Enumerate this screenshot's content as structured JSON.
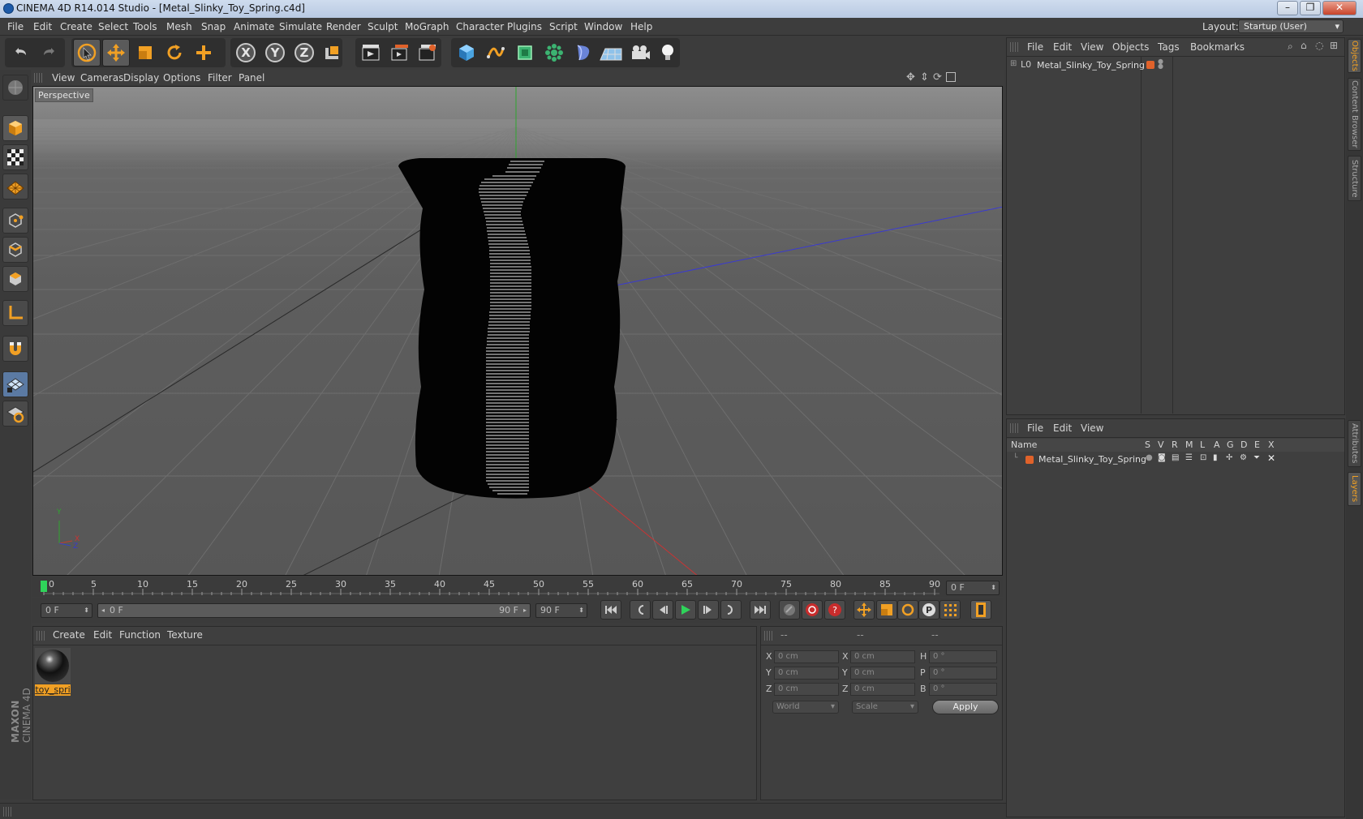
{
  "window": {
    "title": "CINEMA 4D R14.014 Studio - [Metal_Slinky_Toy_Spring.c4d]"
  },
  "menubar": {
    "items": [
      "File",
      "Edit",
      "Create",
      "Select",
      "Tools",
      "Mesh",
      "Snap",
      "Animate",
      "Simulate",
      "Render",
      "Sculpt",
      "MoGraph",
      "Character",
      "Plugins",
      "Script",
      "Window",
      "Help"
    ],
    "layout_label": "Layout:",
    "layout_value": "Startup (User)"
  },
  "toolbar": {
    "icons": [
      "undo-icon",
      "redo-icon",
      "live-select-icon",
      "move-icon",
      "scale-icon",
      "rotate-icon",
      "add-icon",
      "x-axis-icon",
      "y-axis-icon",
      "z-axis-icon",
      "world-coord-icon",
      "render-view-icon",
      "render-picture-viewer-icon",
      "edit-render-settings-icon",
      "cube-icon",
      "spline-icon",
      "nurbs-icon",
      "array-icon",
      "deformer-icon",
      "floor-icon",
      "camera-icon",
      "light-icon"
    ],
    "axis_x": "X",
    "axis_y": "Y",
    "axis_z": "Z"
  },
  "viewport": {
    "menu": [
      "View",
      "Cameras",
      "Display",
      "Options",
      "Filter",
      "Panel"
    ],
    "label": "Perspective",
    "axis_x": "X",
    "axis_y": "Y",
    "axis_z": "Z"
  },
  "timeline": {
    "ticks": [
      "0",
      "5",
      "10",
      "15",
      "20",
      "25",
      "30",
      "35",
      "40",
      "45",
      "50",
      "55",
      "60",
      "65",
      "70",
      "75",
      "80",
      "85",
      "90"
    ],
    "current_frame": "0 F"
  },
  "playbar": {
    "start_frame": "0 F",
    "range_start": "0 F",
    "range_end": "90 F",
    "end_frame": "90 F"
  },
  "material_panel": {
    "menu": [
      "Create",
      "Edit",
      "Function",
      "Texture"
    ],
    "material_name": "toy_spri"
  },
  "attributes": {
    "headers": [
      "--",
      "--",
      "--"
    ],
    "rows": [
      {
        "a": "X",
        "av": "0 cm",
        "b": "X",
        "bv": "0 cm",
        "c": "H",
        "cv": "0 °"
      },
      {
        "a": "Y",
        "av": "0 cm",
        "b": "Y",
        "bv": "0 cm",
        "c": "P",
        "cv": "0 °"
      },
      {
        "a": "Z",
        "av": "0 cm",
        "b": "Z",
        "bv": "0 cm",
        "c": "B",
        "cv": "0 °"
      }
    ],
    "coord_mode": "World",
    "size_mode": "Scale",
    "apply_label": "Apply"
  },
  "objects_panel": {
    "menu": [
      "File",
      "Edit",
      "View",
      "Objects",
      "Tags",
      "Bookmarks"
    ],
    "object_name": "Metal_Slinky_Toy_Spring",
    "object_color": "#e0622a"
  },
  "layers_panel": {
    "menu": [
      "File",
      "Edit",
      "View"
    ],
    "columns": [
      "Name",
      "S",
      "V",
      "R",
      "M",
      "L",
      "A",
      "G",
      "D",
      "E",
      "X"
    ],
    "layer_name": "Metal_Slinky_Toy_Spring"
  },
  "right_tabs": [
    "Objects",
    "Content Browser",
    "Structure",
    "Attributes",
    "Layers"
  ],
  "branding": {
    "brand": "MAXON",
    "product": "CINEMA 4D"
  },
  "colors": {
    "accent": "#f1a024",
    "x_axis": "#c83434",
    "y_axis": "#2fa52f",
    "z_axis": "#3a3aca"
  }
}
